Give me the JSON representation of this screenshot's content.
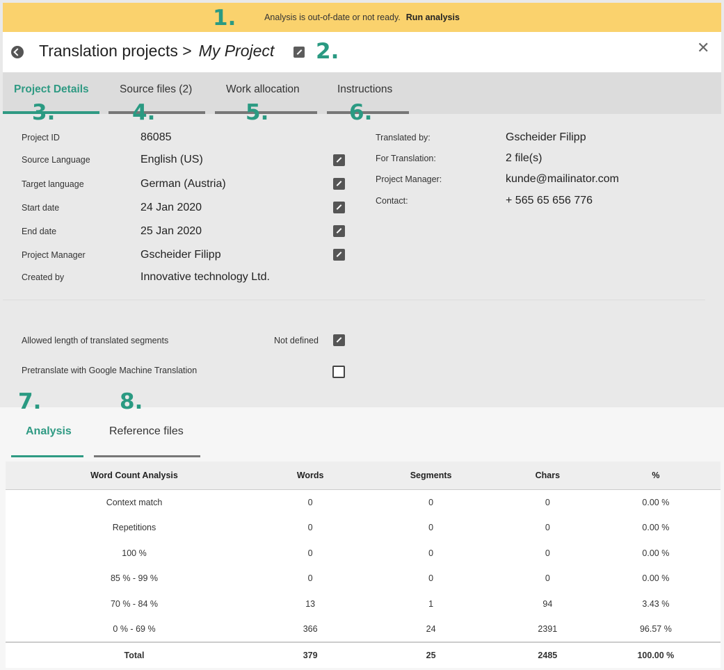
{
  "banner": {
    "message": "Analysis is out-of-date or not ready.",
    "action": "Run analysis"
  },
  "header": {
    "breadcrumb": "Translation projects >",
    "project_name": "My Project"
  },
  "tabs": [
    {
      "label": "Project Details",
      "active": true
    },
    {
      "label": "Source files (2)",
      "active": false
    },
    {
      "label": "Work allocation",
      "active": false
    },
    {
      "label": "Instructions",
      "active": false
    }
  ],
  "callouts": [
    "1.",
    "2.",
    "3.",
    "4.",
    "5.",
    "6.",
    "7.",
    "8."
  ],
  "details_left": [
    {
      "label": "Project ID",
      "value": "86085",
      "editable": false
    },
    {
      "label": "Source Language",
      "value": "English (US)",
      "editable": true
    },
    {
      "label": "Target language",
      "value": "German (Austria)",
      "editable": true
    },
    {
      "label": "Start date",
      "value": "24 Jan 2020",
      "editable": true
    },
    {
      "label": "End date",
      "value": "25 Jan 2020",
      "editable": true
    },
    {
      "label": "Project Manager",
      "value": "Gscheider Filipp",
      "editable": true
    },
    {
      "label": "Created by",
      "value": "Innovative technology Ltd.",
      "editable": false
    }
  ],
  "details_right": [
    {
      "label": "Translated by:",
      "value": "Gscheider Filipp"
    },
    {
      "label": "For Translation:",
      "value": "2 file(s)"
    },
    {
      "label": "Project Manager:",
      "value": "kunde@mailinator.com"
    },
    {
      "label": "Contact:",
      "value": "+ 565 65 656 776"
    }
  ],
  "options": {
    "allowed_length_label": "Allowed length of translated segments",
    "allowed_length_value": "Not defined",
    "pretranslate_label": "Pretranslate with Google Machine Translation",
    "pretranslate_checked": false
  },
  "subtabs": [
    {
      "label": "Analysis",
      "active": true
    },
    {
      "label": "Reference files",
      "active": false
    }
  ],
  "word_count": {
    "headers": [
      "Word Count Analysis",
      "Words",
      "Segments",
      "Chars",
      "%"
    ],
    "rows": [
      [
        "Context match",
        "0",
        "0",
        "0",
        "0.00 %"
      ],
      [
        "Repetitions",
        "0",
        "0",
        "0",
        "0.00 %"
      ],
      [
        "100 %",
        "0",
        "0",
        "0",
        "0.00 %"
      ],
      [
        "85 % - 99 %",
        "0",
        "0",
        "0",
        "0.00 %"
      ],
      [
        "70 % - 84 %",
        "13",
        "1",
        "94",
        "3.43 %"
      ],
      [
        "0 % - 69 %",
        "366",
        "24",
        "2391",
        "96.57 %"
      ]
    ],
    "total": [
      "Total",
      "379",
      "25",
      "2485",
      "100.00 %"
    ]
  },
  "colors": {
    "accent": "#2f9a83",
    "banner": "#fad26d"
  }
}
